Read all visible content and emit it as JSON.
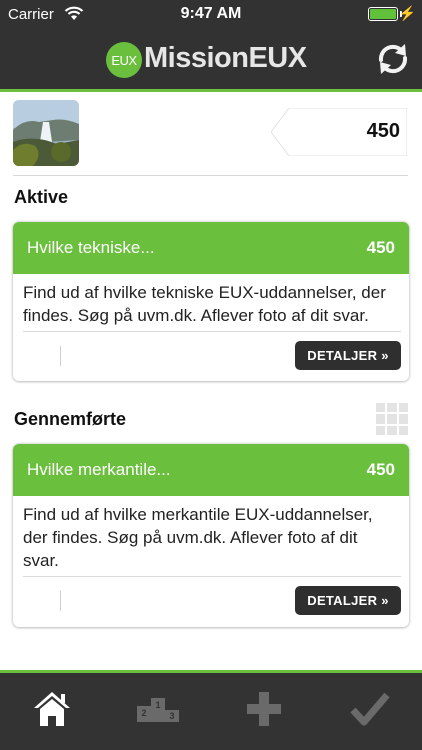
{
  "status_bar": {
    "carrier": "Carrier",
    "time": "9:47 AM"
  },
  "header": {
    "logo_text": "EUX",
    "title": "MissionEUX",
    "refresh_icon": "refresh-icon"
  },
  "profile": {
    "score": "450"
  },
  "sections": {
    "active": "Aktive",
    "completed": "Gennemførte"
  },
  "cards": [
    {
      "title": "Hvilke tekniske...",
      "points": "450",
      "description": "Find ud af hvilke tekniske EUX-uddannelser, der findes. Søg på uvm.dk. Aflever foto af dit svar.",
      "button": "DETALJER »"
    },
    {
      "title": "Hvilke merkantile...",
      "points": "450",
      "description": "Find ud af hvilke merkantile EUX-uddannelser, der findes. Søg på uvm.dk. Aflever foto af dit svar.",
      "button": "DETALJER »"
    }
  ],
  "tabs": [
    "home-icon",
    "leaderboard-icon",
    "add-icon",
    "check-icon"
  ],
  "colors": {
    "accent": "#6abf3d",
    "bar": "#323232",
    "button": "#2f2f2f"
  }
}
